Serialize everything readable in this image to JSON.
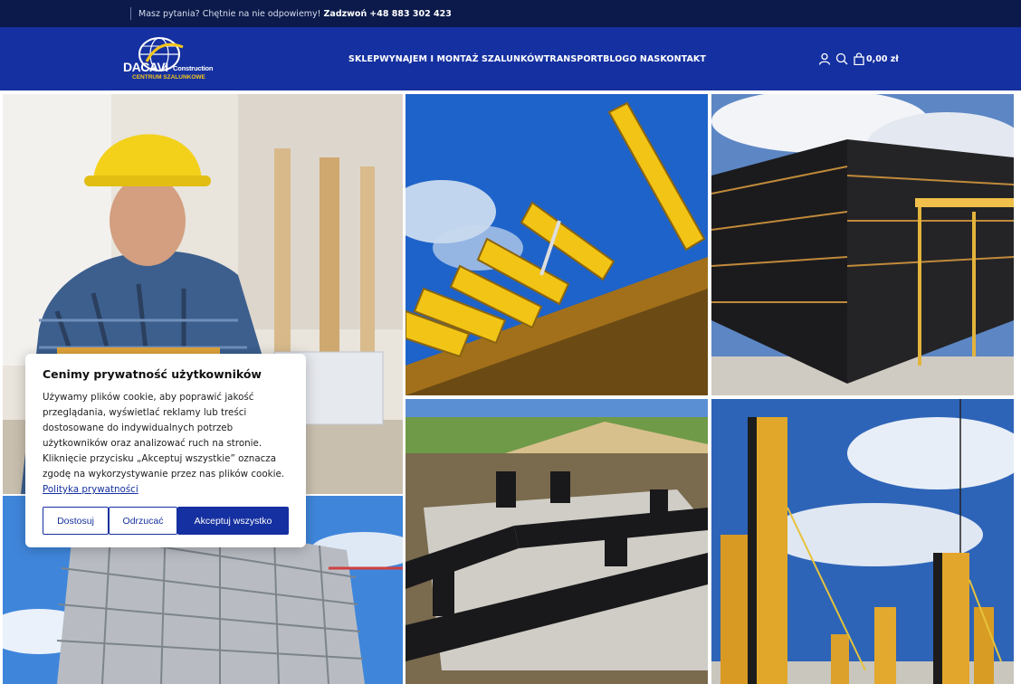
{
  "topbar": {
    "text": "Masz pytania? Chętnie na nie odpowiemy!",
    "call_label": "Zadzwoń",
    "phone": "+48 883 302 423"
  },
  "logo": {
    "brand": "DACAVI",
    "brand_suffix": "Construction",
    "tagline": "CENTRUM SZALUNKOWE"
  },
  "nav": {
    "items": [
      {
        "label": "SKLEP"
      },
      {
        "label": "WYNAJEM I MONTAŻ SZALUNKÓW"
      },
      {
        "label": "TRANSPORT"
      },
      {
        "label": "BLOG"
      },
      {
        "label": "O NAS"
      },
      {
        "label": "KONTAKT"
      }
    ]
  },
  "header_icons": [
    "user-icon",
    "search-icon",
    "cart-icon"
  ],
  "cart": {
    "total": "0,00 zł"
  },
  "colors": {
    "topbar": "#0b1a4a",
    "header": "#1530a0",
    "accent": "#f4c51d"
  },
  "gallery": [
    {
      "subject": "worker-in-hard-hat"
    },
    {
      "subject": "yellow-formwork-beams"
    },
    {
      "subject": "black-wall-formwork"
    },
    {
      "subject": "high-rise-scaffolding"
    },
    {
      "subject": "foundation-formwork"
    },
    {
      "subject": "column-formwork"
    }
  ],
  "cookie": {
    "title": "Cenimy prywatność użytkowników",
    "body": "Używamy plików cookie, aby poprawić jakość przeglądania, wyświetlać reklamy lub treści dostosowane do indywidualnych potrzeb użytkowników oraz analizować ruch na stronie. Kliknięcie przycisku „Akceptuj wszystkie” oznacza zgodę na wykorzystywanie przez nas plików cookie.",
    "policy_link": "Polityka prywatności",
    "buttons": {
      "customize": "Dostosuj",
      "reject": "Odrzucać",
      "accept": "Akceptuj wszystko"
    }
  }
}
